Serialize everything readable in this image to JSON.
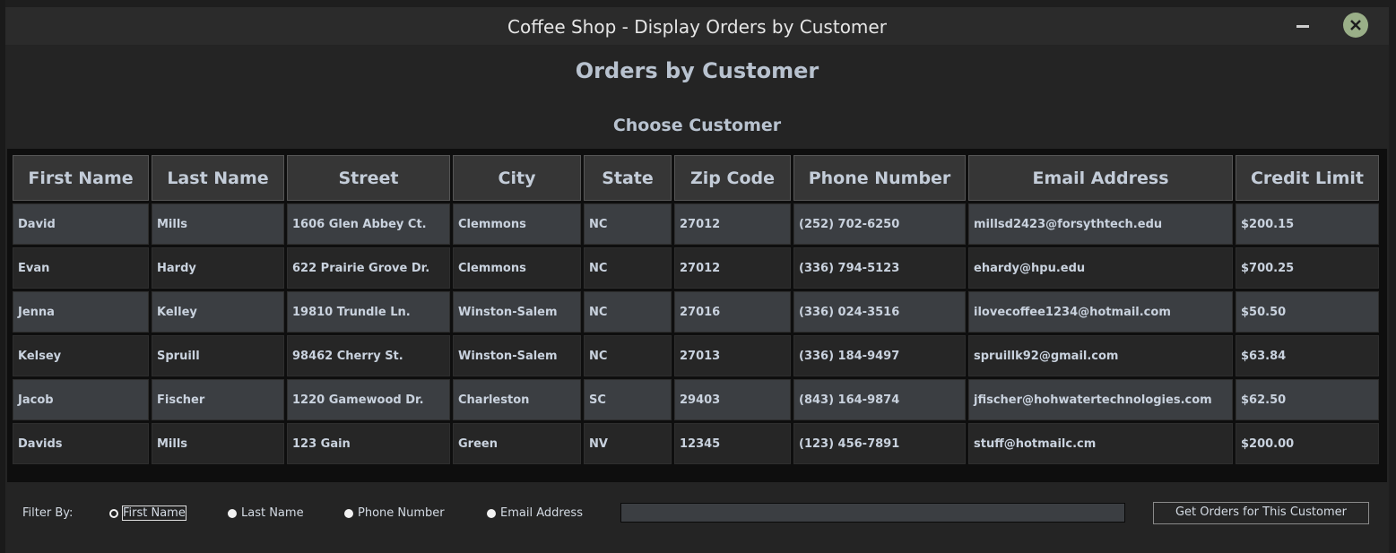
{
  "window": {
    "title": "Coffee Shop - Display Orders by Customer"
  },
  "header": {
    "heading": "Orders by Customer",
    "subheading": "Choose Customer"
  },
  "table": {
    "columns": [
      "First Name",
      "Last Name",
      "Street",
      "City",
      "State",
      "Zip Code",
      "Phone Number",
      "Email Address",
      "Credit Limit"
    ],
    "rows": [
      [
        "David",
        "Mills",
        "1606 Glen Abbey Ct.",
        "Clemmons",
        "NC",
        "27012",
        "(252) 702-6250",
        "millsd2423@forsythtech.edu",
        "$200.15"
      ],
      [
        "Evan",
        "Hardy",
        "622 Prairie Grove Dr.",
        "Clemmons",
        "NC",
        "27012",
        "(336) 794-5123",
        "ehardy@hpu.edu",
        "$700.25"
      ],
      [
        "Jenna",
        "Kelley",
        "19810 Trundle Ln.",
        "Winston-Salem",
        "NC",
        "27016",
        "(336) 024-3516",
        "ilovecoffee1234@hotmail.com",
        "$50.50"
      ],
      [
        "Kelsey",
        "Spruill",
        "98462 Cherry St.",
        "Winston-Salem",
        "NC",
        "27013",
        "(336) 184-9497",
        "spruillk92@gmail.com",
        "$63.84"
      ],
      [
        "Jacob",
        "Fischer",
        "1220 Gamewood Dr.",
        "Charleston",
        "SC",
        "29403",
        "(843) 164-9874",
        "jfischer@hohwatertechnologies.com",
        "$62.50"
      ],
      [
        "Davids",
        "Mills",
        "123 Gain",
        "Green",
        "NV",
        "12345",
        "(123) 456-7891",
        "stuff@hotmailc.cm",
        "$200.00"
      ]
    ]
  },
  "filter": {
    "label": "Filter By:",
    "options": [
      "First Name",
      "Last Name",
      "Phone Number",
      "Email Address"
    ],
    "selected": "First Name",
    "search_value": "",
    "button_label": "Get Orders for This Customer"
  },
  "icons": {
    "minimize": "minimize-icon",
    "close": "close-icon"
  },
  "colors": {
    "close_button": "#9aaf88",
    "odd_row": "#3b3e42",
    "even_row": "#262626",
    "header_text": "#b8c2cf"
  }
}
